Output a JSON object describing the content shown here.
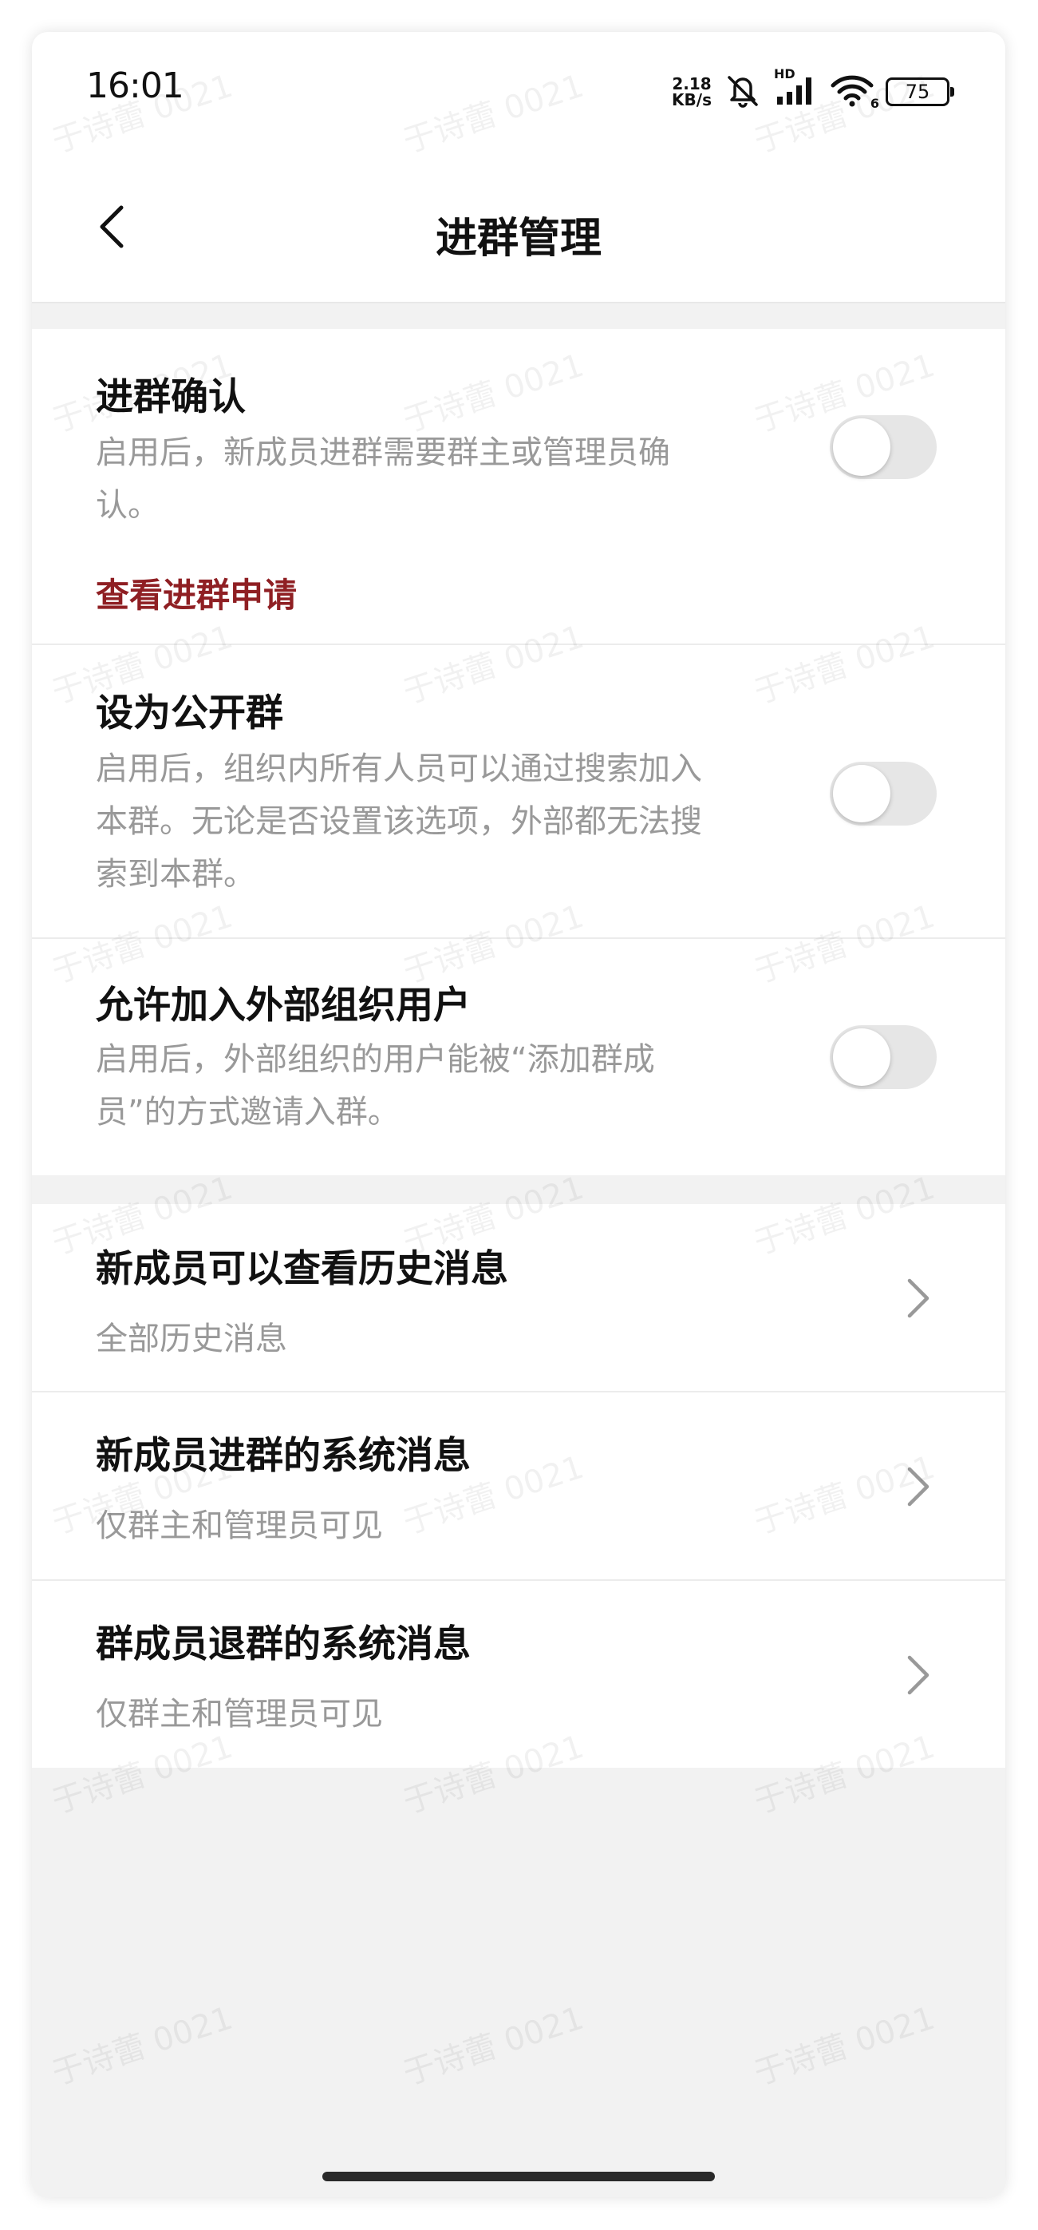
{
  "status_bar": {
    "time": "16:01",
    "net_speed_value": "2.18",
    "net_speed_unit": "KB/s",
    "hd_label": "HD",
    "wifi_label": "6",
    "battery": "75"
  },
  "header": {
    "title": "进群管理"
  },
  "settings": {
    "join_confirm": {
      "title": "进群确认",
      "description": "启用后，新成员进群需要群主或管理员确认。",
      "link": "查看进群申请",
      "enabled": false
    },
    "public_group": {
      "title": "设为公开群",
      "description": "启用后，组织内所有人员可以通过搜索加入本群。无论是否设置该选项，外部都无法搜索到本群。",
      "enabled": false
    },
    "external_users": {
      "title": "允许加入外部组织用户",
      "description": "启用后，外部组织的用户能被“添加群成员”的方式邀请入群。",
      "enabled": false
    }
  },
  "options": [
    {
      "title": "新成员可以查看历史消息",
      "value": "全部历史消息"
    },
    {
      "title": "新成员进群的系统消息",
      "value": "仅群主和管理员可见"
    },
    {
      "title": "群成员退群的系统消息",
      "value": "仅群主和管理员可见"
    }
  ],
  "watermark": "于诗蕾 0021",
  "colors": {
    "link": "#8f1f23",
    "background": "#f2f2f2",
    "toggle_off": "#e6e6e6"
  }
}
